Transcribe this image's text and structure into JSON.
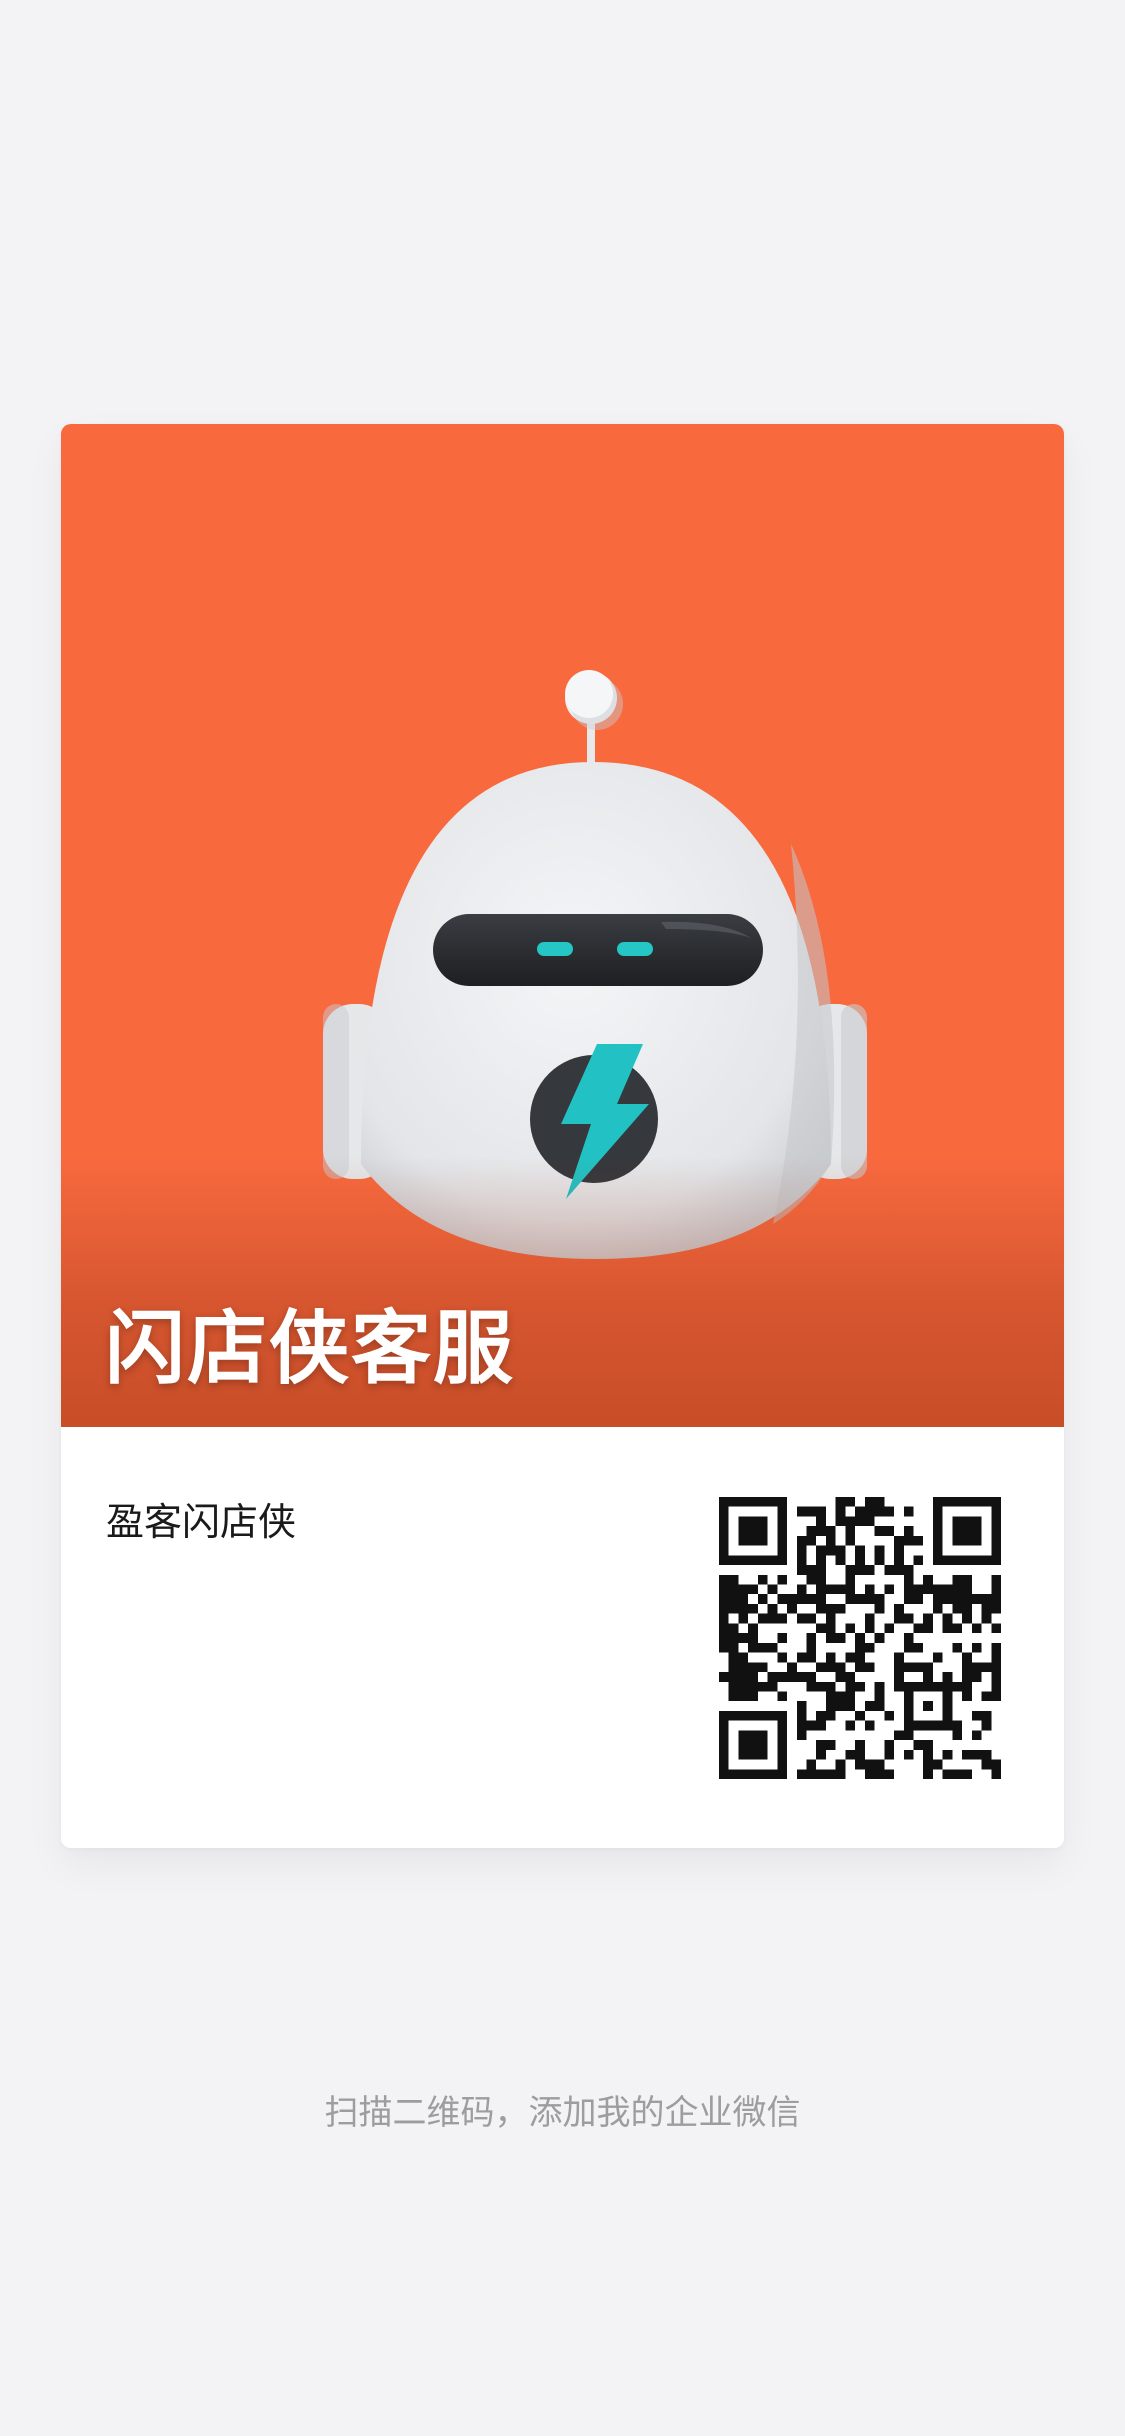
{
  "card": {
    "banner_title": "闪店侠客服",
    "company_name": "盈客闪店侠",
    "banner_color": "#f8693e",
    "logo_icon": "robot-mascot-icon",
    "qr_icon": "wecom-qr-code"
  },
  "footer": {
    "hint": "扫描二维码，添加我的企业微信"
  }
}
